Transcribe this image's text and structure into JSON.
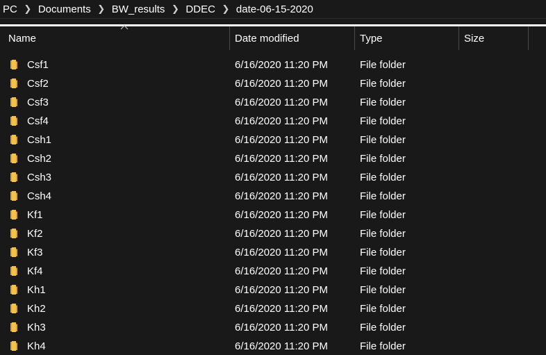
{
  "breadcrumb": {
    "items": [
      "PC",
      "Documents",
      "BW_results",
      "DDEC",
      "date-06-15-2020"
    ]
  },
  "columns": {
    "name": "Name",
    "date_modified": "Date modified",
    "type": "Type",
    "size": "Size"
  },
  "icons": {
    "folder": "folder-icon",
    "separator": "chevron-right-icon",
    "sort": "sort-ascending-icon"
  },
  "colors": {
    "background": "#191919",
    "folder_body": "#f3c24b",
    "folder_back": "#d9a336",
    "text": "#ffffff"
  },
  "files": [
    {
      "name": "Csf1",
      "date": "6/16/2020 11:20 PM",
      "type": "File folder",
      "size": ""
    },
    {
      "name": "Csf2",
      "date": "6/16/2020 11:20 PM",
      "type": "File folder",
      "size": ""
    },
    {
      "name": "Csf3",
      "date": "6/16/2020 11:20 PM",
      "type": "File folder",
      "size": ""
    },
    {
      "name": "Csf4",
      "date": "6/16/2020 11:20 PM",
      "type": "File folder",
      "size": ""
    },
    {
      "name": "Csh1",
      "date": "6/16/2020 11:20 PM",
      "type": "File folder",
      "size": ""
    },
    {
      "name": "Csh2",
      "date": "6/16/2020 11:20 PM",
      "type": "File folder",
      "size": ""
    },
    {
      "name": "Csh3",
      "date": "6/16/2020 11:20 PM",
      "type": "File folder",
      "size": ""
    },
    {
      "name": "Csh4",
      "date": "6/16/2020 11:20 PM",
      "type": "File folder",
      "size": ""
    },
    {
      "name": "Kf1",
      "date": "6/16/2020 11:20 PM",
      "type": "File folder",
      "size": ""
    },
    {
      "name": "Kf2",
      "date": "6/16/2020 11:20 PM",
      "type": "File folder",
      "size": ""
    },
    {
      "name": "Kf3",
      "date": "6/16/2020 11:20 PM",
      "type": "File folder",
      "size": ""
    },
    {
      "name": "Kf4",
      "date": "6/16/2020 11:20 PM",
      "type": "File folder",
      "size": ""
    },
    {
      "name": "Kh1",
      "date": "6/16/2020 11:20 PM",
      "type": "File folder",
      "size": ""
    },
    {
      "name": "Kh2",
      "date": "6/16/2020 11:20 PM",
      "type": "File folder",
      "size": ""
    },
    {
      "name": "Kh3",
      "date": "6/16/2020 11:20 PM",
      "type": "File folder",
      "size": ""
    },
    {
      "name": "Kh4",
      "date": "6/16/2020 11:20 PM",
      "type": "File folder",
      "size": ""
    }
  ]
}
